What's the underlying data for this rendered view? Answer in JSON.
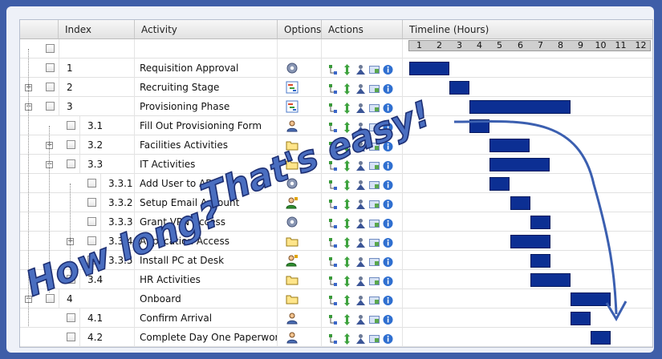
{
  "headers": {
    "index": "Index",
    "activity": "Activity",
    "options": "Options",
    "actions": "Actions",
    "timeline": "Timeline (Hours)"
  },
  "timeline_ticks": [
    "1",
    "2",
    "3",
    "4",
    "5",
    "6",
    "7",
    "8",
    "9",
    "10",
    "11",
    "12"
  ],
  "rows": [
    {
      "index": "",
      "activity": "",
      "level": 0,
      "toggle": "",
      "option_icon": "",
      "start": null,
      "duration": null
    },
    {
      "index": "1",
      "activity": "Requisition Approval",
      "level": 0,
      "toggle": "",
      "option_icon": "gear-icon",
      "start": 1,
      "duration": 2
    },
    {
      "index": "2",
      "activity": "Recruiting Stage",
      "level": 0,
      "toggle": "+",
      "option_icon": "task-board-icon",
      "start": 3,
      "duration": 1
    },
    {
      "index": "3",
      "activity": "Provisioning Phase",
      "level": 0,
      "toggle": "-",
      "option_icon": "task-board-icon",
      "start": 4,
      "duration": 5
    },
    {
      "index": "3.1",
      "activity": "Fill Out Provisioning Form",
      "level": 1,
      "toggle": "",
      "option_icon": "user-icon",
      "start": 4,
      "duration": 1
    },
    {
      "index": "3.2",
      "activity": "Facilities Activities",
      "level": 1,
      "toggle": "+",
      "option_icon": "folder-icon",
      "start": 5,
      "duration": 2
    },
    {
      "index": "3.3",
      "activity": "IT Activities",
      "level": 1,
      "toggle": "-",
      "option_icon": "folder-icon",
      "start": 5,
      "duration": 3
    },
    {
      "index": "3.3.1",
      "activity": "Add User to AD",
      "level": 2,
      "toggle": "",
      "option_icon": "gear-icon",
      "start": 5,
      "duration": 1
    },
    {
      "index": "3.3.2",
      "activity": "Setup Email Account",
      "level": 2,
      "toggle": "",
      "option_icon": "user-add-icon",
      "start": 6,
      "duration": 1
    },
    {
      "index": "3.3.3",
      "activity": "Grant VPN Access",
      "level": 2,
      "toggle": "",
      "option_icon": "gear-icon",
      "start": 7,
      "duration": 1
    },
    {
      "index": "3.3.4",
      "activity": "Application Access",
      "level": 2,
      "toggle": "+",
      "option_icon": "folder-icon",
      "start": 6,
      "duration": 2
    },
    {
      "index": "3.3.5",
      "activity": "Install PC at Desk",
      "level": 2,
      "toggle": "",
      "option_icon": "user-add-icon",
      "start": 7,
      "duration": 1
    },
    {
      "index": "3.4",
      "activity": "HR Activities",
      "level": 1,
      "toggle": "+",
      "option_icon": "folder-icon",
      "start": 7,
      "duration": 2
    },
    {
      "index": "4",
      "activity": "Onboard",
      "level": 0,
      "toggle": "-",
      "option_icon": "folder-icon",
      "start": 9,
      "duration": 2
    },
    {
      "index": "4.1",
      "activity": "Confirm Arrival",
      "level": 1,
      "toggle": "",
      "option_icon": "user-icon",
      "start": 9,
      "duration": 1
    },
    {
      "index": "4.2",
      "activity": "Complete Day One Paperwork",
      "level": 1,
      "toggle": "",
      "option_icon": "user-icon",
      "start": 10,
      "duration": 1
    }
  ],
  "action_icons": [
    "hierarchy-icon",
    "move-icon",
    "assign-icon",
    "link-icon",
    "info-icon"
  ],
  "overlay": {
    "line1": "How long?",
    "line2": "That's easy!"
  },
  "colors": {
    "bar": "#0c2f93",
    "background": "#3f5ea8",
    "overlay_text": "#3b5fb0",
    "arrow": "#3b5fb0"
  }
}
